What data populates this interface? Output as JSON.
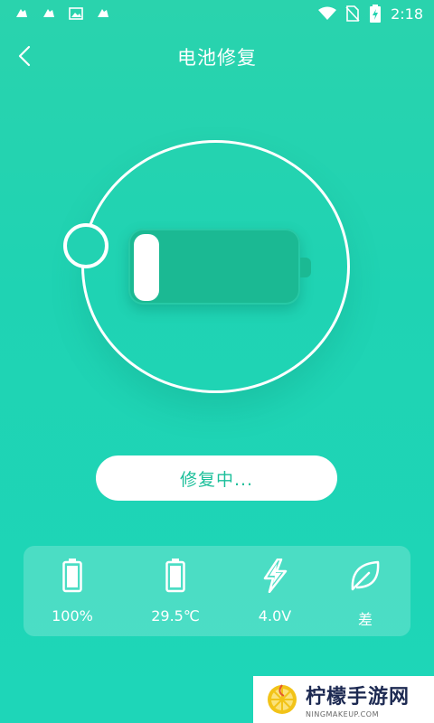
{
  "status_bar": {
    "time": "2:18",
    "left_icons": [
      "notification-icon",
      "notification-icon",
      "image-icon",
      "notification-icon"
    ],
    "right_icons": [
      "wifi-icon",
      "no-sim-icon",
      "battery-charging-icon"
    ]
  },
  "header": {
    "title": "电池修复",
    "back_icon": "chevron-left-icon"
  },
  "battery_visual": {
    "charge_level": 0.15
  },
  "repair_button": {
    "label": "修复中..."
  },
  "stats": [
    {
      "icon": "battery-full-icon",
      "value": "100%"
    },
    {
      "icon": "battery-icon",
      "value": "29.5℃"
    },
    {
      "icon": "lightning-icon",
      "value": "4.0V"
    },
    {
      "icon": "leaf-icon",
      "value": "差"
    }
  ],
  "watermark": {
    "brand": "柠檬手游网",
    "url": "NINGMAKEUP.COM"
  },
  "colors": {
    "background": "#22d3b0",
    "accent": "#1bbf9a",
    "battery_body": "#1bb993"
  }
}
